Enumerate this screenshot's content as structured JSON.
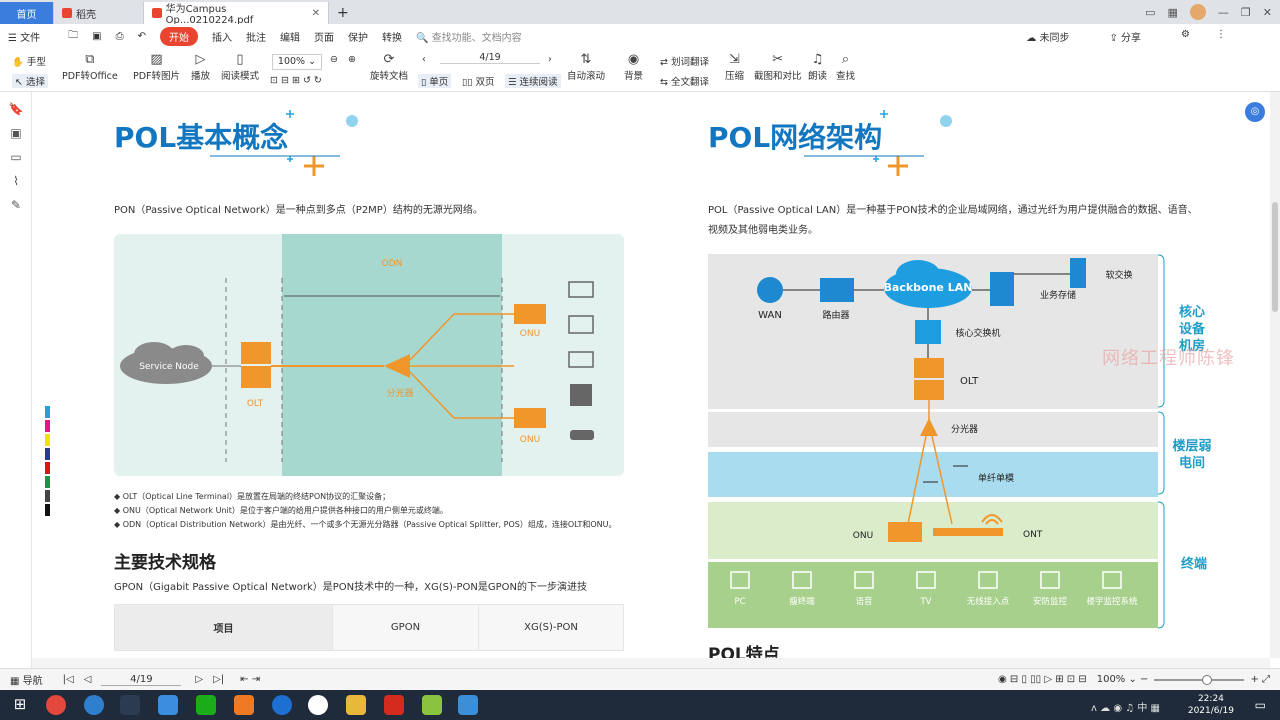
{
  "tabs": [
    {
      "label": "首页"
    },
    {
      "label": "稻壳"
    },
    {
      "label": "华为Campus Op...0210224.pdf"
    }
  ],
  "menu": {
    "file": "文件",
    "items": [
      "开始",
      "插入",
      "批注",
      "编辑",
      "页面",
      "保护",
      "转换"
    ],
    "search": "查找功能、文档内容",
    "sync": "未同步",
    "share": "分享"
  },
  "toolbar": {
    "hand": "手型",
    "select": "选择",
    "pdf2office": "PDF转Office",
    "pdf2img": "PDF转图片",
    "play": "播放",
    "readmode": "阅读模式",
    "zoom": "100%",
    "page": "4/19",
    "rotate": "旋转文档",
    "single": "单页",
    "double": "双页",
    "continuous": "连续阅读",
    "autoscroll": "自动滚动",
    "bg": "背景",
    "translate": "划词翻译",
    "fulltranslate": "全文翻译",
    "compress": "压缩",
    "screenshot": "截图和对比",
    "read": "朗读",
    "find": "查找"
  },
  "left": {
    "title": "POL基本概念",
    "intro": "PON（Passive Optical Network）是一种点到多点（P2MP）结构的无源光网络。",
    "diagram": {
      "odn": "ODN",
      "service_node": "Service Node",
      "olt": "OLT",
      "splitter": "分光器",
      "onu1": "ONU",
      "onu2": "ONU"
    },
    "bullets": [
      "◆ OLT（Optical Line Terminal）是放置在局端的终结PON协议的汇聚设备；",
      "◆ ONU（Optical Network Unit）是位于客户端的给用户提供各种接口的用户侧单元或终端。",
      "◆ ODN（Optical Distribution Network）是由光纤、一个或多个无源光分路器（Passive Optical Splitter, POS）组成，连接OLT和ONU。"
    ],
    "spec_title": "主要技术规格",
    "spec_intro": "GPON（Gigabit Passive Optical Network）是PON技术中的一种，XG(S)-PON是GPON的下一步演进技",
    "table_headers": [
      "项目",
      "GPON",
      "XG(S)-PON"
    ]
  },
  "right": {
    "title": "POL网络架构",
    "intro1": "POL（Passive Optical LAN）是一种基于PON技术的企业局域网络，通过光纤为用户提供融合的数据、语音、",
    "intro2": "视频及其他弱电类业务。",
    "diagram": {
      "backbone": "Backbone LAN",
      "wan": "WAN",
      "router": "路由器",
      "storage": "业务存储",
      "softswitch": "软交换",
      "core_switch": "核心交换机",
      "olt": "OLT",
      "splitter": "分光器",
      "fiber": "单纤单模",
      "onu": "ONU",
      "ont": "ONT",
      "terminals": [
        "PC",
        "瘦终端",
        "语音",
        "TV",
        "无线接入点",
        "安防监控",
        "楼宇监控系统"
      ]
    },
    "zones": [
      "核心设备机房",
      "楼层弱电间",
      "终端"
    ],
    "next_heading": "POL特点"
  },
  "watermark": "网络工程师陈锋",
  "status": {
    "nav": "导航",
    "page": "4/19",
    "zoom": "100%"
  },
  "clock": {
    "time": "22:24",
    "date": "2021/6/19"
  },
  "colors": {
    "accent": "#1277c0",
    "orange": "#f0962b",
    "teal": "#a6d8cf",
    "kaishi": "#e8442f"
  }
}
